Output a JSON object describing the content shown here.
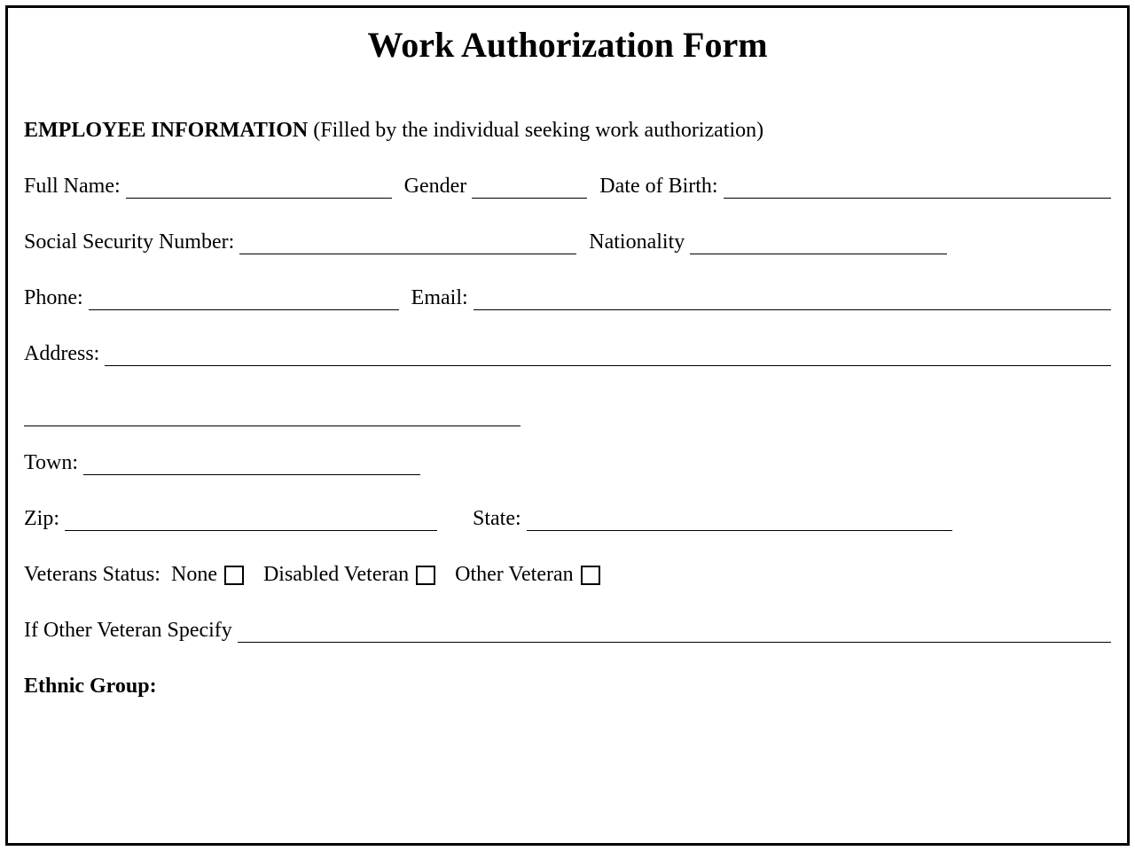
{
  "title": "Work Authorization Form",
  "section": {
    "heading": "EMPLOYEE INFORMATION",
    "subtext": " (Filled by the individual seeking work authorization)"
  },
  "labels": {
    "full_name": "Full Name:",
    "gender": "Gender",
    "dob": "Date of Birth:",
    "ssn": "Social Security Number:",
    "nationality": "Nationality",
    "phone": "Phone:",
    "email": "Email:",
    "address": "Address:",
    "town": "Town:",
    "zip": "Zip:",
    "state": "State:",
    "veterans_status": "Veterans Status:",
    "vet_none": "None",
    "vet_disabled": "Disabled Veteran",
    "vet_other": "Other Veteran",
    "if_other_specify": "If Other Veteran  Specify",
    "ethnic_group": "Ethnic Group:"
  }
}
